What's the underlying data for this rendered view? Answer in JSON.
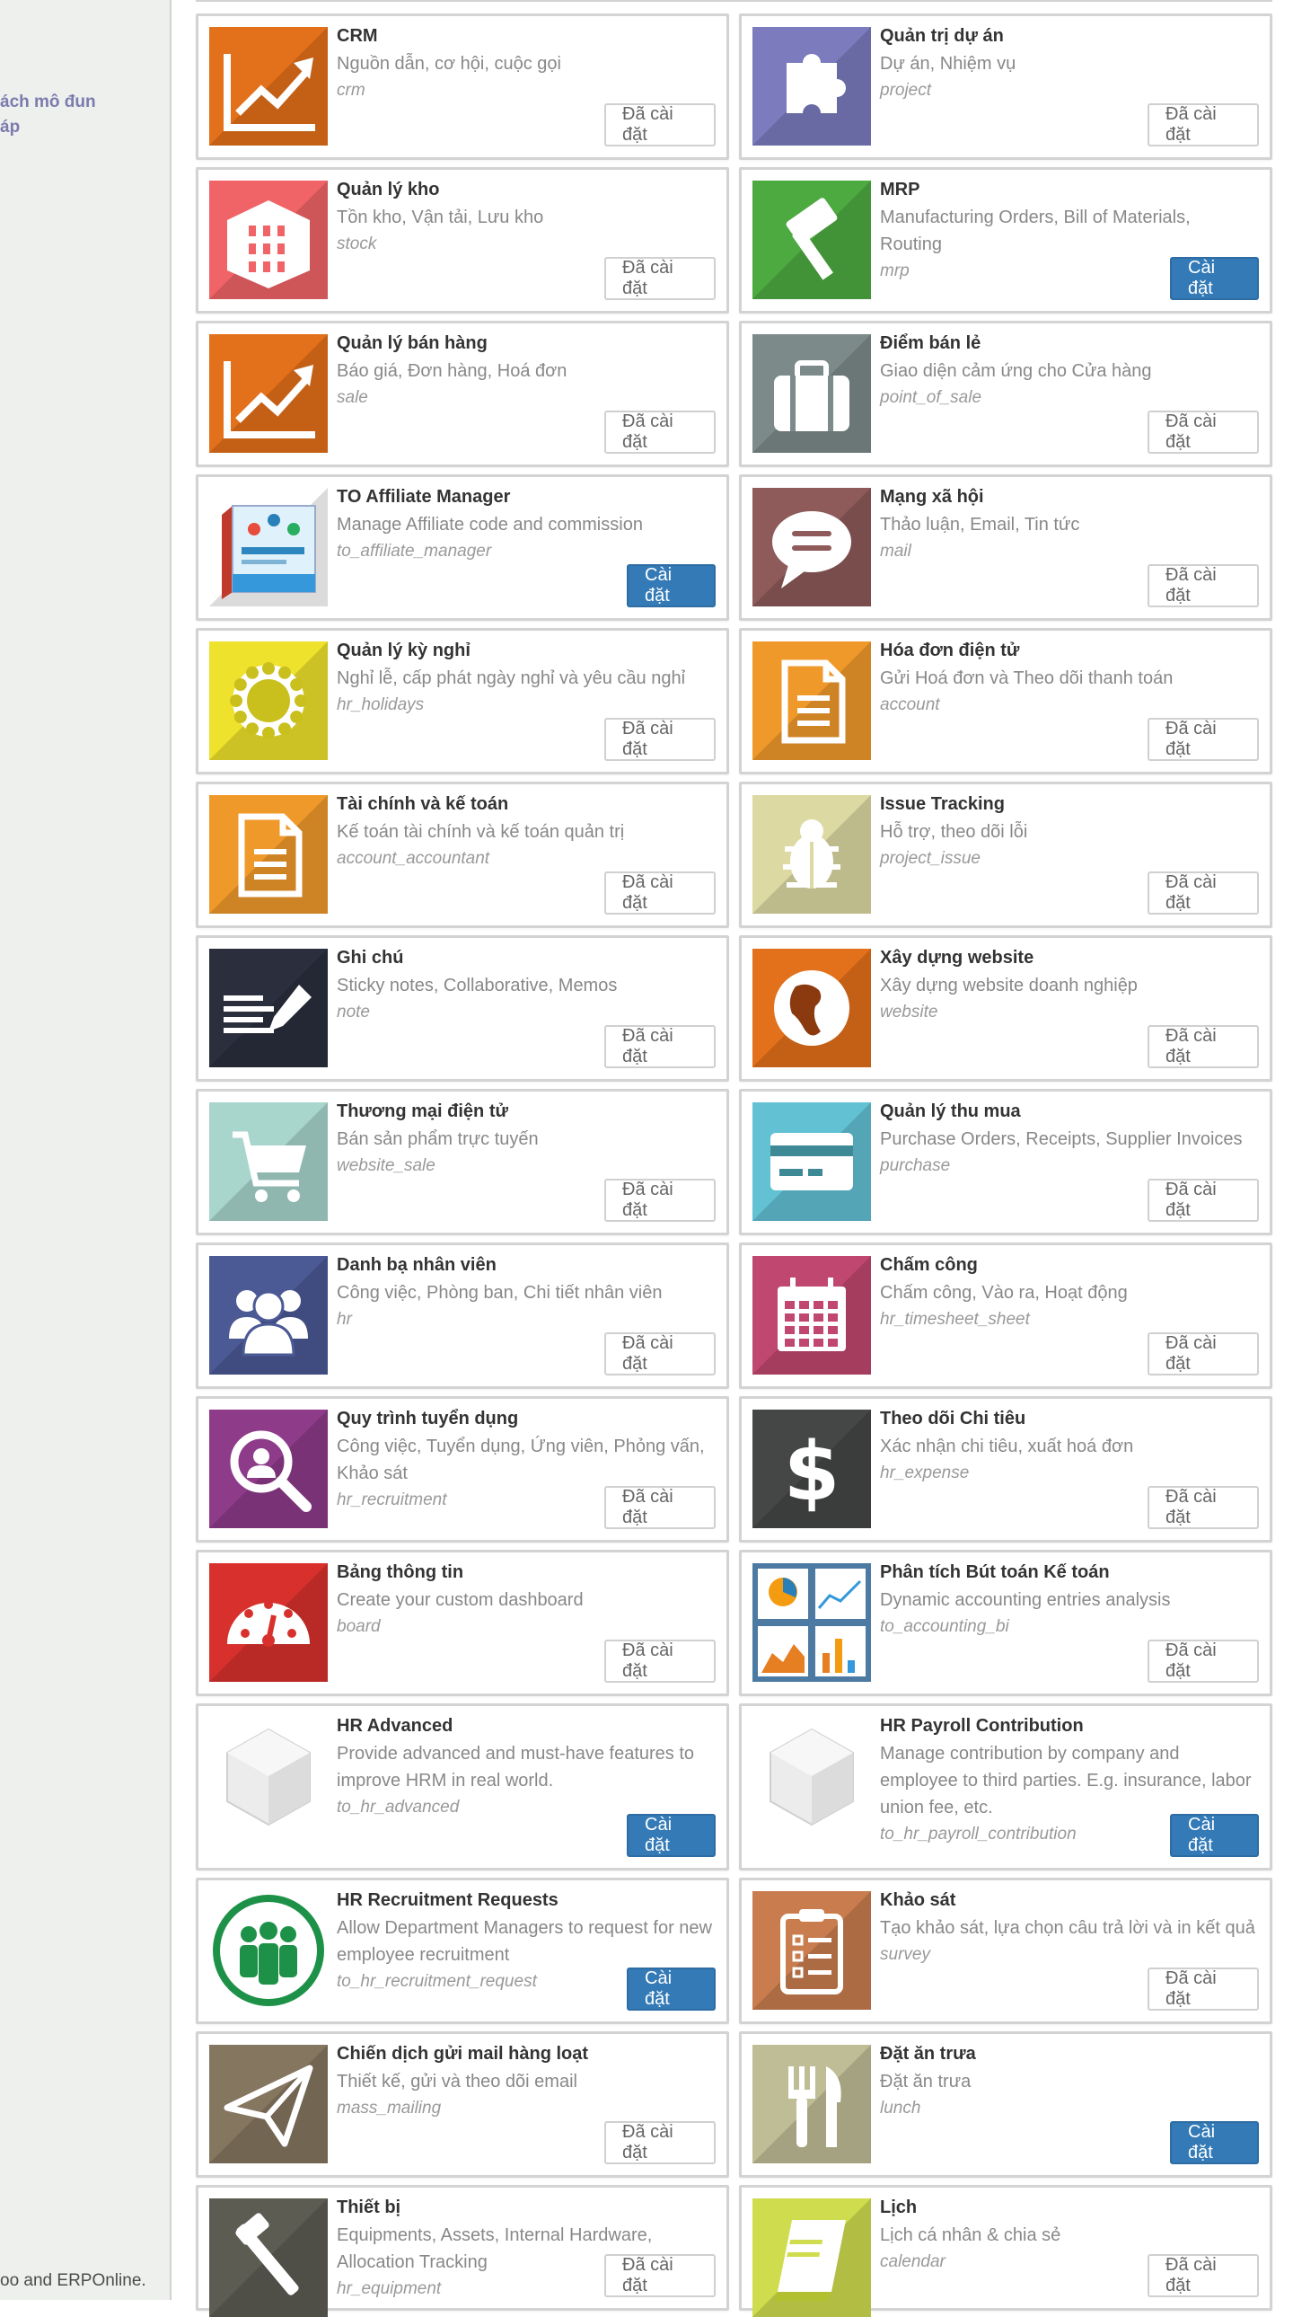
{
  "sidebar": {
    "link_text": "ách mô đun\náp",
    "footer": "oo and ERPOnline."
  },
  "labels": {
    "installed": "Đã cài đặt",
    "install": "Cài đặt"
  },
  "apps": [
    {
      "title": "CRM",
      "summary": "Nguồn dẫn, cơ hội, cuộc gọi",
      "tech": "crm",
      "installed": true,
      "icon": "crm-chart-icon",
      "bg": "#e3701a"
    },
    {
      "title": "Quản trị dự án",
      "summary": "Dự án, Nhiệm vụ",
      "tech": "project",
      "installed": true,
      "icon": "puzzle-icon",
      "bg": "#7b7bbe"
    },
    {
      "title": "Quản lý kho",
      "summary": "Tồn kho, Vận tải, Lưu kho",
      "tech": "stock",
      "installed": true,
      "icon": "warehouse-icon",
      "bg": "#f06467"
    },
    {
      "title": "MRP",
      "summary": "Manufacturing Orders, Bill of Materials, Routing",
      "tech": "mrp",
      "installed": false,
      "icon": "hammer-icon",
      "bg": "#4daa40"
    },
    {
      "title": "Quản lý bán hàng",
      "summary": "Báo giá, Đơn hàng, Hoá đơn",
      "tech": "sale",
      "installed": true,
      "icon": "sales-chart-icon",
      "bg": "#e3701a"
    },
    {
      "title": "Điểm bán lẻ",
      "summary": "Giao diện cảm ứng cho Cửa hàng",
      "tech": "point_of_sale",
      "installed": true,
      "icon": "briefcase-icon",
      "bg": "#7d8a8a"
    },
    {
      "title": "TO Affiliate Manager",
      "summary": "Manage Affiliate code and commission",
      "tech": "to_affiliate_manager",
      "installed": false,
      "icon": "affiliate-box-icon",
      "bg": "#ffffff"
    },
    {
      "title": "Mạng xã hội",
      "summary": "Thảo luận, Email, Tin tức",
      "tech": "mail",
      "installed": true,
      "icon": "chat-bubble-icon",
      "bg": "#8e5a5a"
    },
    {
      "title": "Quản lý kỳ nghỉ",
      "summary": "Nghỉ lễ, cấp phát ngày nghỉ và yêu cầu nghỉ",
      "tech": "hr_holidays",
      "installed": true,
      "icon": "sun-icon",
      "bg": "#efe22c"
    },
    {
      "title": "Hóa đơn điện tử",
      "summary": "Gửi Hoá đơn và Theo dõi thanh toán",
      "tech": "account",
      "installed": true,
      "icon": "invoice-doc-icon",
      "bg": "#f0992b"
    },
    {
      "title": "Tài chính và kế toán",
      "summary": "Kế toán tài chính và kế toán quản trị",
      "tech": "account_accountant",
      "installed": true,
      "icon": "accounting-doc-icon",
      "bg": "#f0992b"
    },
    {
      "title": "Issue Tracking",
      "summary": "Hỗ trợ, theo dõi lỗi",
      "tech": "project_issue",
      "installed": true,
      "icon": "bug-icon",
      "bg": "#ddd9a3"
    },
    {
      "title": "Ghi chú",
      "summary": "Sticky notes, Collaborative, Memos",
      "tech": "note",
      "installed": true,
      "icon": "note-pen-icon",
      "bg": "#2a2e3d"
    },
    {
      "title": "Xây dựng website",
      "summary": "Xây dựng website doanh nghiệp",
      "tech": "website",
      "installed": true,
      "icon": "globe-icon",
      "bg": "#e3701a"
    },
    {
      "title": "Thương mại điện tử",
      "summary": "Bán sản phẩm trực tuyến",
      "tech": "website_sale",
      "installed": true,
      "icon": "cart-icon",
      "bg": "#a8d5cc"
    },
    {
      "title": "Quản lý thu mua",
      "summary": "Purchase Orders, Receipts, Supplier Invoices",
      "tech": "purchase",
      "installed": true,
      "icon": "credit-card-icon",
      "bg": "#62c2d4"
    },
    {
      "title": "Danh bạ nhân viên",
      "summary": "Công việc, Phòng ban, Chi tiết nhân viên",
      "tech": "hr",
      "installed": true,
      "icon": "people-icon",
      "bg": "#4b5994"
    },
    {
      "title": "Chấm công",
      "summary": "Chấm công, Vào ra, Hoạt động",
      "tech": "hr_timesheet_sheet",
      "installed": true,
      "icon": "calendar-grid-icon",
      "bg": "#c0476f"
    },
    {
      "title": "Quy trình tuyển dụng",
      "summary": "Công việc, Tuyển dụng, Ứng viên, Phỏng vấn, Khảo sát",
      "tech": "hr_recruitment",
      "installed": true,
      "icon": "search-person-icon",
      "bg": "#8e3b8a"
    },
    {
      "title": "Theo dõi Chi tiêu",
      "summary": "Xác nhận chi tiêu, xuất hoá đơn",
      "tech": "hr_expense",
      "installed": true,
      "icon": "dollar-icon",
      "bg": "#444745"
    },
    {
      "title": "Bảng thông tin",
      "summary": "Create your custom dashboard",
      "tech": "board",
      "installed": true,
      "icon": "gauge-icon",
      "bg": "#d8312d"
    },
    {
      "title": "Phân tích Bút toán Kế toán",
      "summary": "Dynamic accounting entries analysis",
      "tech": "to_accounting_bi",
      "installed": true,
      "icon": "charts-panel-icon",
      "bg": "#4c7aa3"
    },
    {
      "title": "HR Advanced",
      "summary": "Provide advanced and must-have features to improve HRM in real world.",
      "tech": "to_hr_advanced",
      "installed": false,
      "icon": "cube-icon",
      "bg": "#ffffff"
    },
    {
      "title": "HR Payroll Contribution",
      "summary": "Manage contribution by company and employee to third parties. E.g. insurance, labor union fee, etc.",
      "tech": "to_hr_payroll_contribution",
      "installed": false,
      "icon": "cube-icon",
      "bg": "#ffffff"
    },
    {
      "title": "HR Recruitment Requests",
      "summary": "Allow Department Managers to request for new employee recruitment",
      "tech": "to_hr_recruitment_request",
      "installed": false,
      "icon": "team-circle-icon",
      "bg": "#ffffff"
    },
    {
      "title": "Khảo sát",
      "summary": "Tạo khảo sát, lựa chọn câu trả lời và in kết quả",
      "tech": "survey",
      "installed": true,
      "icon": "clipboard-icon",
      "bg": "#c97d4e"
    },
    {
      "title": "Chiến dịch gửi mail hàng loạt",
      "summary": "Thiết kế, gửi và theo dõi email",
      "tech": "mass_mailing",
      "installed": true,
      "icon": "paper-plane-icon",
      "bg": "#857660"
    },
    {
      "title": "Đặt ăn trưa",
      "summary": "Đặt ăn trưa",
      "tech": "lunch",
      "installed": false,
      "icon": "cutlery-icon",
      "bg": "#bfbd96"
    },
    {
      "title": "Thiết bị",
      "summary": "Equipments, Assets, Internal Hardware, Allocation Tracking",
      "tech": "hr_equipment",
      "installed": true,
      "icon": "tools-icon",
      "bg": "#5d5c53"
    },
    {
      "title": "Lịch",
      "summary": "Lịch cá nhân & chia sẻ",
      "tech": "calendar",
      "installed": true,
      "icon": "book-icon",
      "bg": "#cfdc4e"
    }
  ]
}
